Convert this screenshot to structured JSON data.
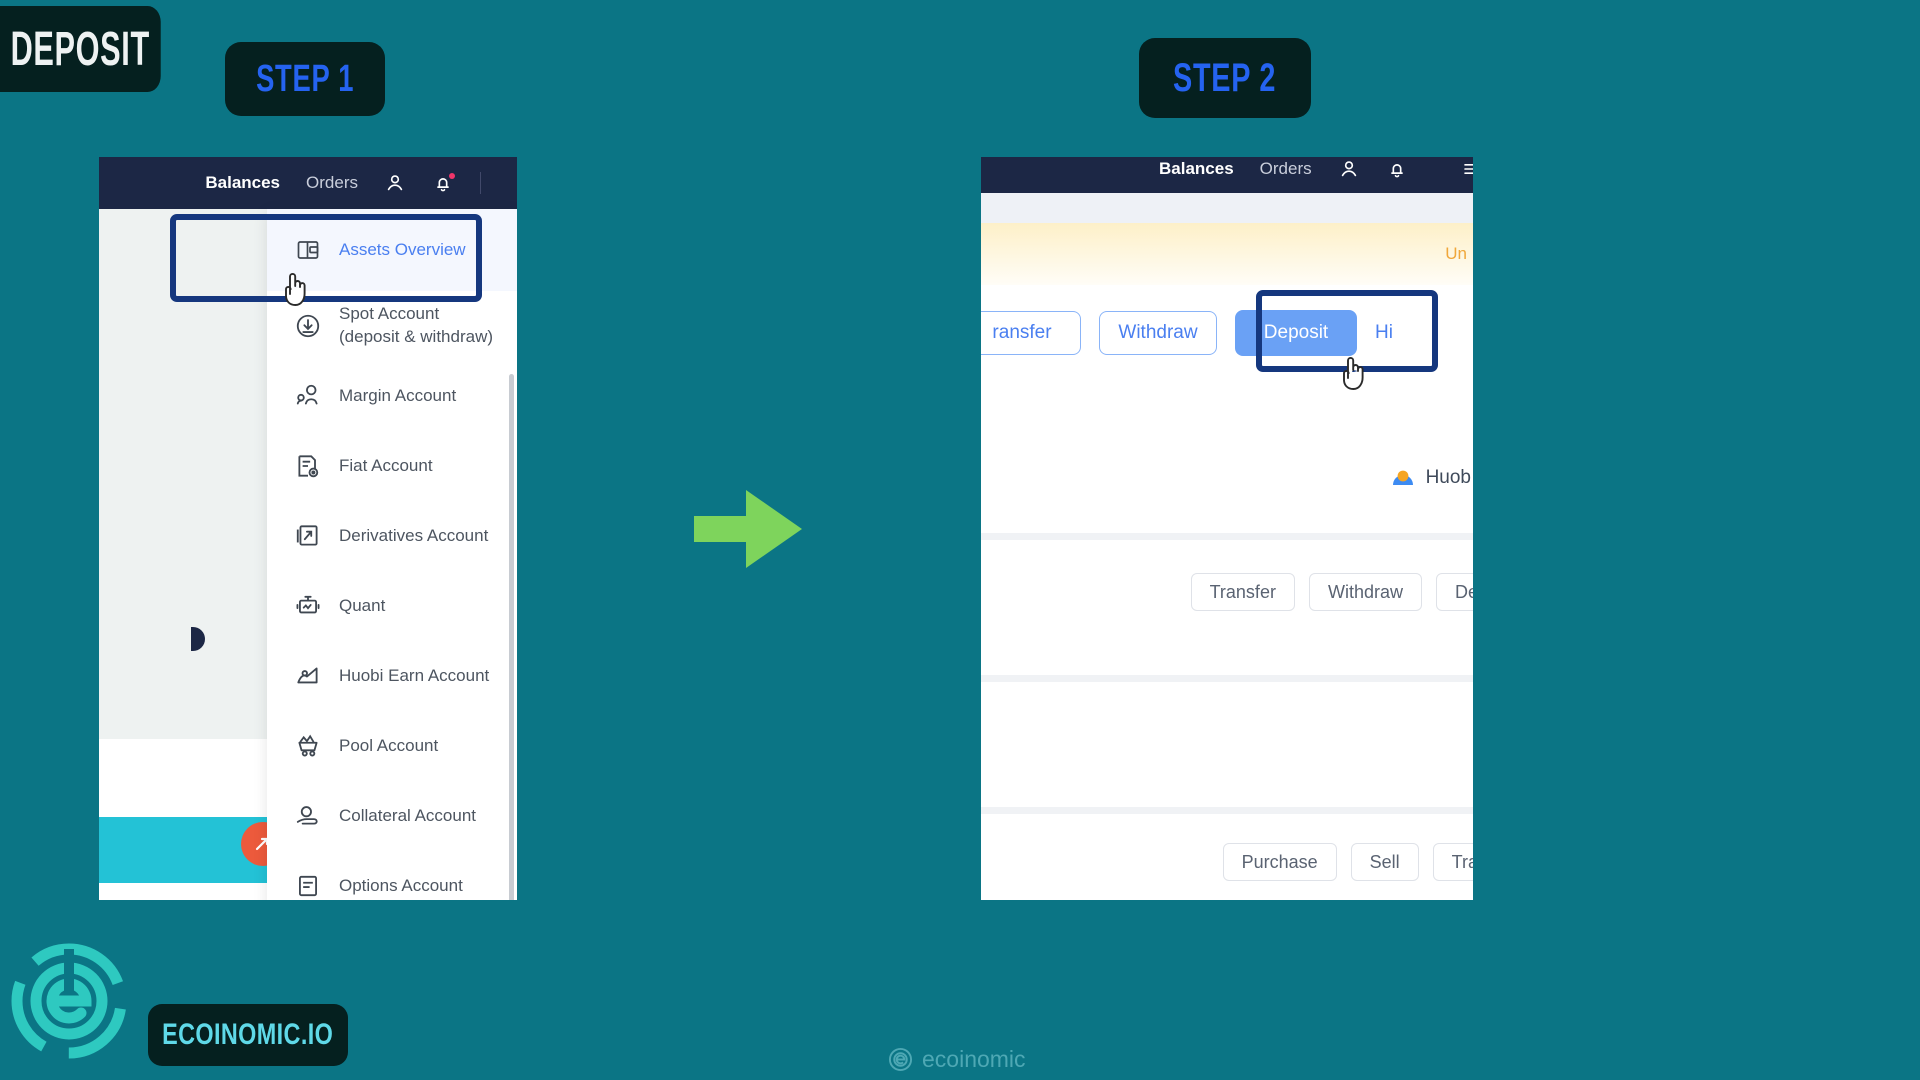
{
  "page": {
    "background_color": "#0b7585",
    "accent_blue": "#2563f0",
    "highlight_border": "#15377e",
    "arrow_color": "#7ed45c"
  },
  "badges": {
    "deposit": "DEPOSIT",
    "step1": "STEP 1",
    "step2": "STEP 2"
  },
  "panel1": {
    "nav": {
      "balances": "Balances",
      "orders": "Orders",
      "profile_icon": "person-icon",
      "bell_icon": "bell-icon"
    },
    "dropdown": {
      "items": [
        {
          "label": "Assets Overview",
          "icon": "wallet-icon",
          "selected": true
        },
        {
          "label": "Spot Account (deposit & withdraw)",
          "icon": "download-circle-icon",
          "selected": false
        },
        {
          "label": "Margin Account",
          "icon": "margin-people-icon",
          "selected": false
        },
        {
          "label": "Fiat Account",
          "icon": "document-coin-icon",
          "selected": false
        },
        {
          "label": "Derivatives Account",
          "icon": "chart-document-icon",
          "selected": false
        },
        {
          "label": "Quant",
          "icon": "robot-icon",
          "selected": false
        },
        {
          "label": "Huobi Earn Account",
          "icon": "earn-icon",
          "selected": false
        },
        {
          "label": "Pool Account",
          "icon": "mining-cart-icon",
          "selected": false
        },
        {
          "label": "Collateral Account",
          "icon": "hand-coin-icon",
          "selected": false
        },
        {
          "label": "Options Account",
          "icon": "options-doc-icon",
          "selected": false
        }
      ]
    }
  },
  "panel2": {
    "nav": {
      "balances": "Balances",
      "orders": "Orders",
      "profile_icon": "person-icon",
      "bell_icon": "bell-icon",
      "menu_icon": "menu-icon"
    },
    "banner": {
      "text": "Un"
    },
    "actions": {
      "transfer": "ransfer",
      "withdraw": "Withdraw",
      "deposit": "Deposit",
      "history": "Hi"
    },
    "huobi_row": {
      "icon": "huobi-coin-icon",
      "label": "Huob"
    },
    "row_buttons_1": [
      "Transfer",
      "Withdraw",
      "Dep"
    ],
    "row_buttons_2": [
      "Purchase",
      "Sell",
      "Tran"
    ]
  },
  "footer": {
    "brand_badge": "ECOINOMIC.IO",
    "watermark": "ecoinomic"
  }
}
